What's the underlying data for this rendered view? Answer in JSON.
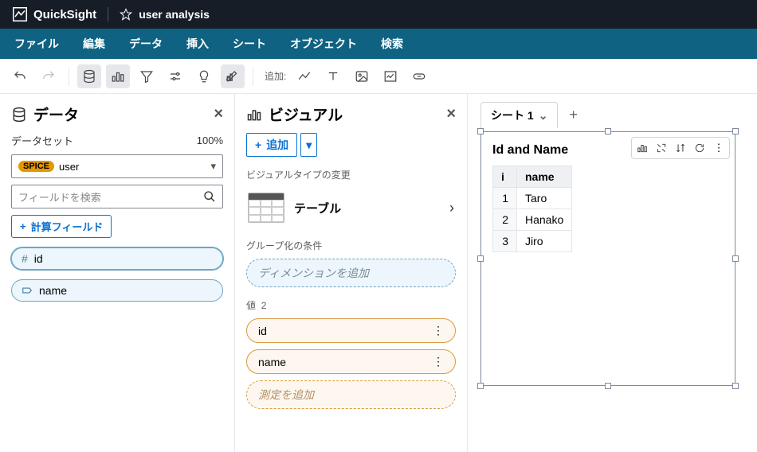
{
  "topbar": {
    "brand": "QuickSight",
    "analysis_name": "user analysis"
  },
  "menubar": [
    "ファイル",
    "編集",
    "データ",
    "挿入",
    "シート",
    "オブジェクト",
    "検索"
  ],
  "toolbar": {
    "add_label": "追加:"
  },
  "data_panel": {
    "title": "データ",
    "dataset_label": "データセット",
    "percent": "100%",
    "spice": "SPICE",
    "dataset_name": "user",
    "search_placeholder": "フィールドを検索",
    "calc_field": "計算フィールド",
    "fields": [
      {
        "name": "id",
        "kind": "number"
      },
      {
        "name": "name",
        "kind": "string"
      }
    ]
  },
  "visual_panel": {
    "title": "ビジュアル",
    "add": "追加",
    "change_type_label": "ビジュアルタイプの変更",
    "type_name": "テーブル",
    "group_label": "グループ化の条件",
    "group_placeholder": "ディメンションを追加",
    "value_label": "値",
    "value_count": "2",
    "value_wells": [
      "id",
      "name"
    ],
    "value_placeholder": "測定を追加"
  },
  "canvas": {
    "sheet_name": "シート 1",
    "visual_title": "Id and Name",
    "table": {
      "headers": [
        "i",
        "name"
      ],
      "rows": [
        [
          "1",
          "Taro"
        ],
        [
          "2",
          "Hanako"
        ],
        [
          "3",
          "Jiro"
        ]
      ]
    }
  }
}
